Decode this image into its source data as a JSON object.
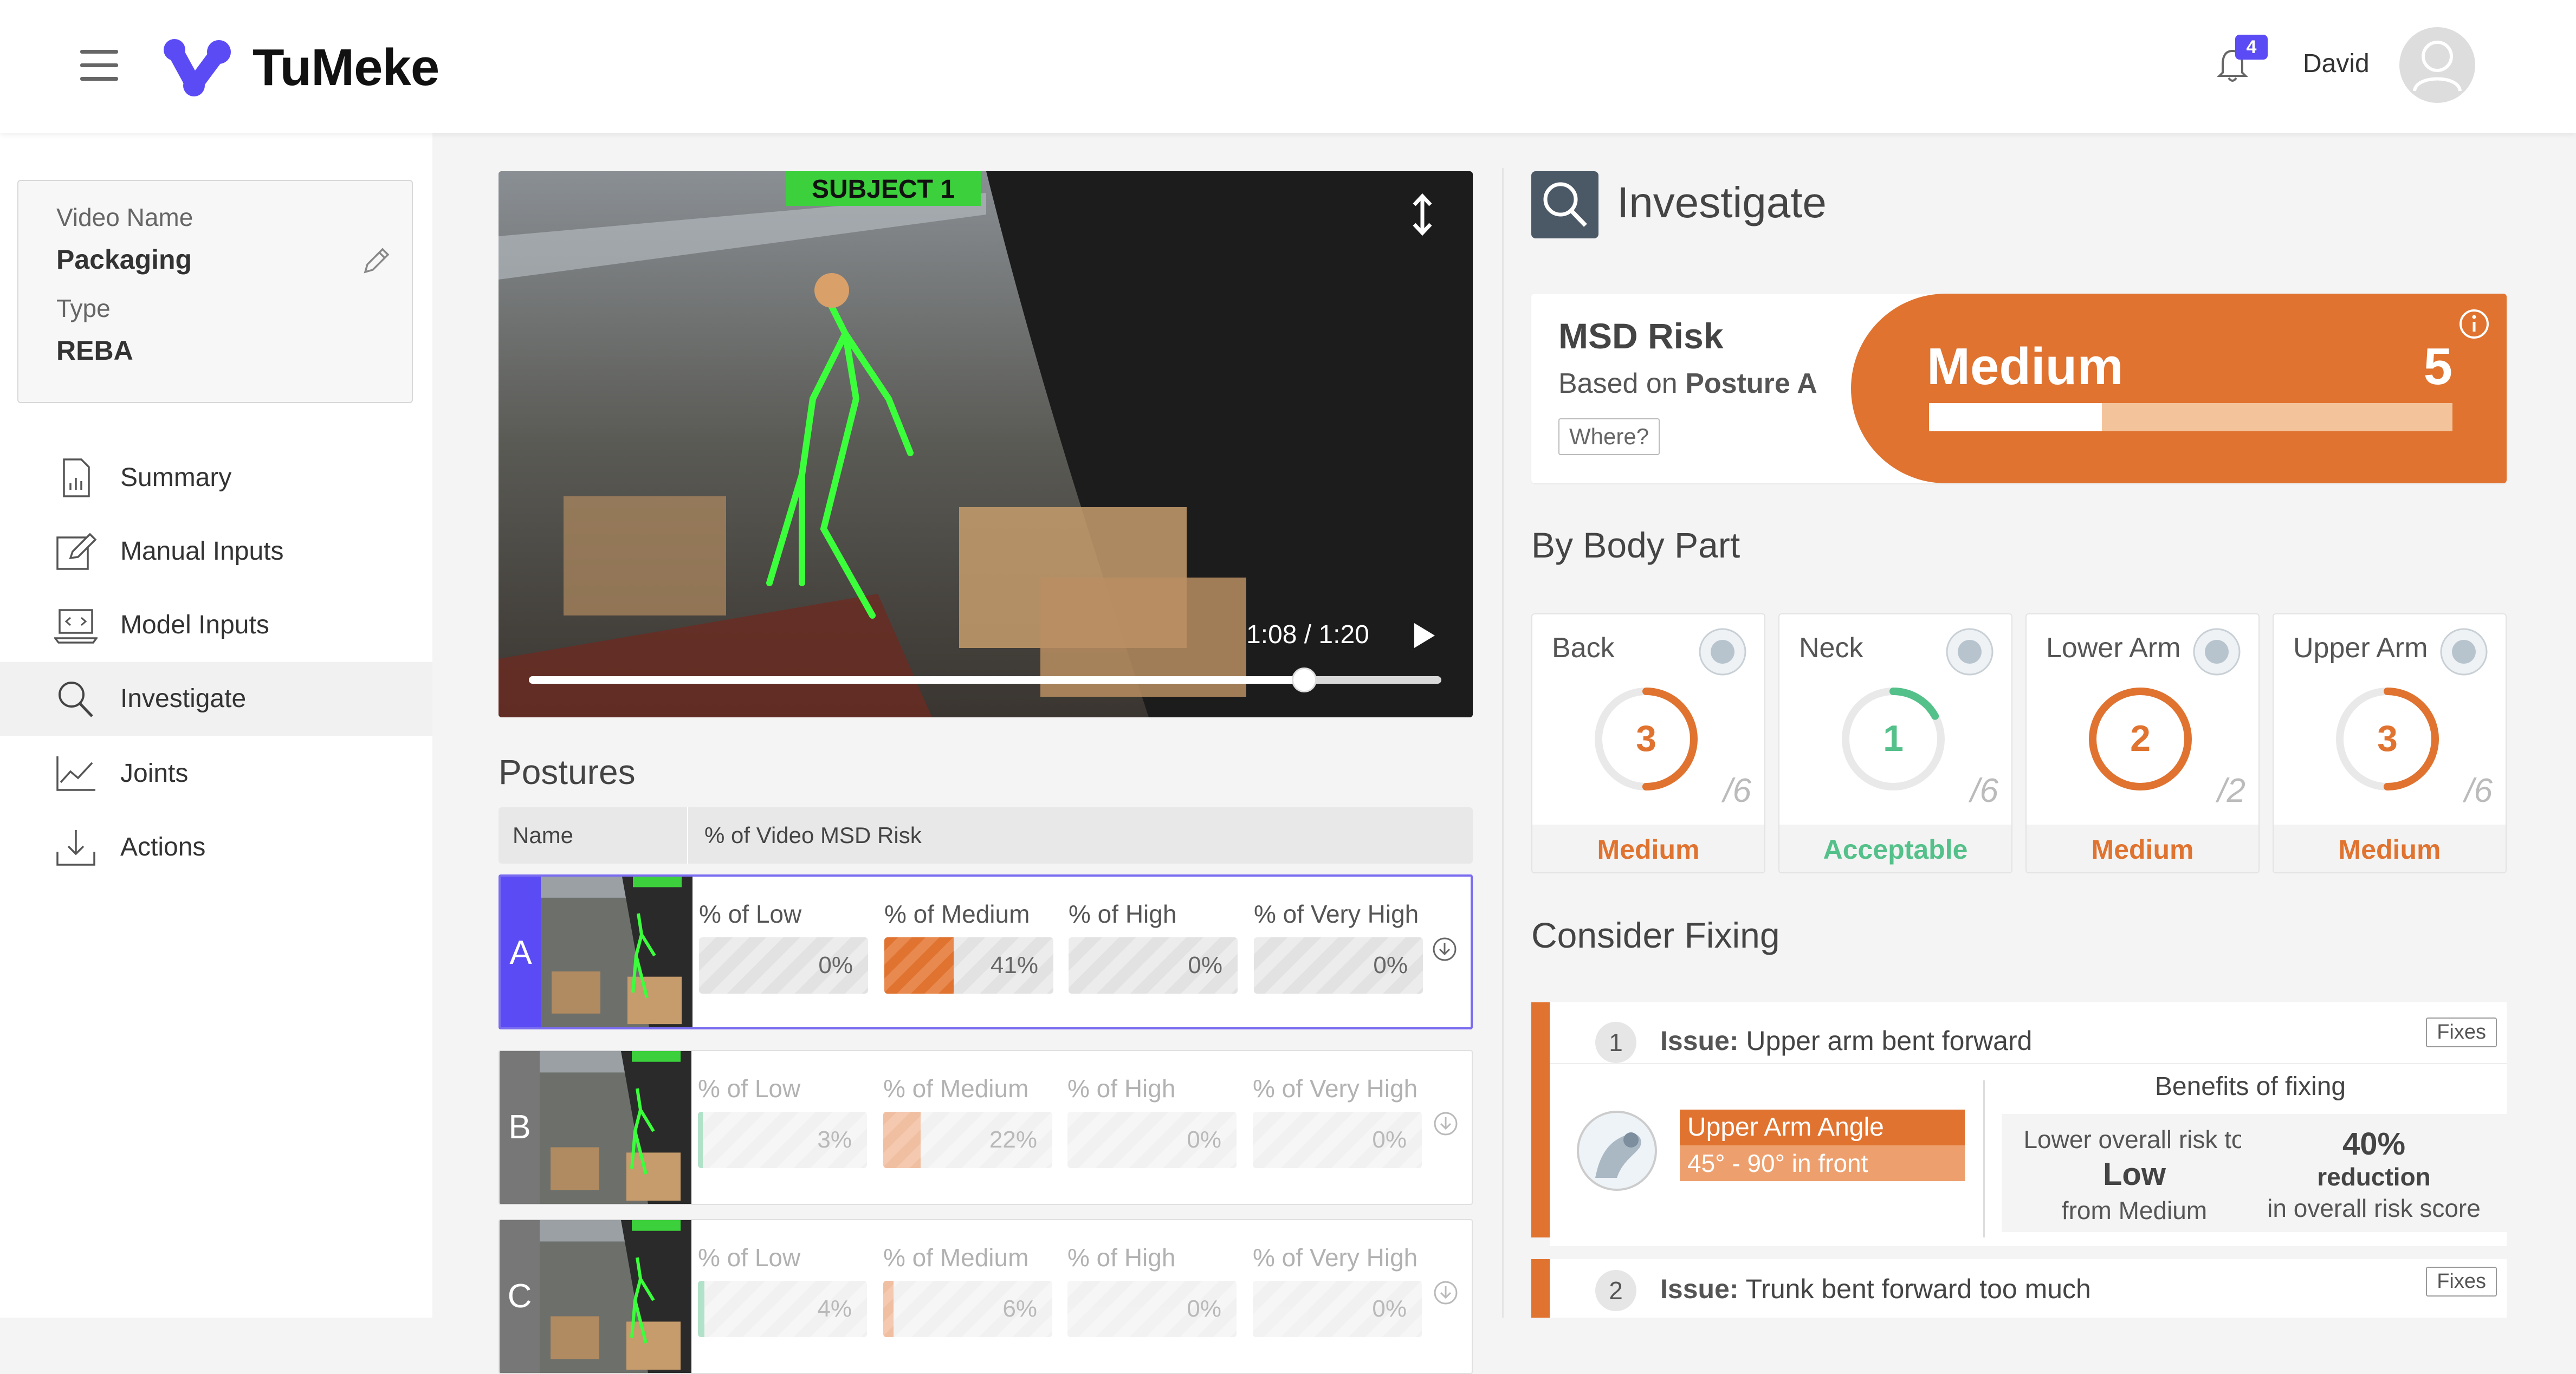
{
  "header": {
    "brand": "TuMeke",
    "notification_count": "4",
    "user_name": "David"
  },
  "video_card": {
    "name_label": "Video Name",
    "name_value": "Packaging",
    "type_label": "Type",
    "type_value": "REBA"
  },
  "nav": [
    {
      "label": "Summary",
      "icon": "report-icon"
    },
    {
      "label": "Manual Inputs",
      "icon": "edit-note-icon"
    },
    {
      "label": "Model Inputs",
      "icon": "laptop-code-icon"
    },
    {
      "label": "Investigate",
      "icon": "search-icon",
      "active": true
    },
    {
      "label": "Joints",
      "icon": "line-chart-icon"
    },
    {
      "label": "Actions",
      "icon": "download-tray-icon"
    }
  ],
  "video": {
    "time": "1:08 / 1:20",
    "progress": 0.85,
    "overlay_label": "SUBJECT 1"
  },
  "postures": {
    "title": "Postures",
    "col_name": "Name",
    "col_risk": "% of Video MSD Risk",
    "rows": [
      {
        "letter": "A",
        "color": "#5b4bf5",
        "labels": [
          "% of Low",
          "% of Medium",
          "% of High",
          "% of Very High"
        ],
        "values": [
          "0%",
          "41%",
          "0%",
          "0%"
        ],
        "fractions": [
          0,
          0.41,
          0,
          0
        ]
      },
      {
        "letter": "B",
        "color": "#777777",
        "labels": [
          "% of Low",
          "% of Medium",
          "% of High",
          "% of Very High"
        ],
        "values": [
          "3%",
          "22%",
          "0%",
          "0%"
        ],
        "fractions": [
          0.03,
          0.22,
          0,
          0
        ]
      },
      {
        "letter": "C",
        "color": "#777777",
        "labels": [
          "% of Low",
          "% of Medium",
          "% of High",
          "% of Very High"
        ],
        "values": [
          "4%",
          "6%",
          "0%",
          "0%"
        ],
        "fractions": [
          0.04,
          0.06,
          0,
          0
        ]
      }
    ]
  },
  "investigate": {
    "title": "Investigate",
    "msd": {
      "title": "MSD Risk",
      "based_prefix": "Based on",
      "based_value": "Posture A",
      "where_label": "Where?",
      "level": "Medium",
      "score": "5",
      "fraction": 0.33,
      "color": "#e07330"
    },
    "body_part_title": "By Body Part",
    "body_parts": [
      {
        "name": "Back",
        "score": "3",
        "max": "/6",
        "fraction": 0.5,
        "level": "Medium",
        "color": "#e07330"
      },
      {
        "name": "Neck",
        "score": "1",
        "max": "/6",
        "fraction": 0.17,
        "level": "Acceptable",
        "color": "#54c08a"
      },
      {
        "name": "Lower Arm",
        "score": "2",
        "max": "/2",
        "fraction": 1.0,
        "level": "Medium",
        "color": "#e07330"
      },
      {
        "name": "Upper Arm",
        "score": "3",
        "max": "/6",
        "fraction": 0.5,
        "level": "Medium",
        "color": "#e07330"
      }
    ],
    "fix_title": "Consider Fixing",
    "fixes": [
      {
        "num": "1",
        "issue_label": "Issue:",
        "issue_text": "Upper arm bent forward",
        "tag": "Fixes",
        "angle_name": "Upper Arm Angle",
        "angle_range": "45° - 90° in front",
        "benefits_title": "Benefits of fixing",
        "benefit1_top": "Lower overall risk to",
        "benefit1_big": "Low",
        "benefit1_bottom": "from Medium",
        "benefit2_big": "40%",
        "benefit2_mid": "reduction",
        "benefit2_bottom": "in overall risk score"
      },
      {
        "num": "2",
        "issue_label": "Issue:",
        "issue_text": "Trunk bent forward too much",
        "tag": "Fixes"
      }
    ]
  }
}
